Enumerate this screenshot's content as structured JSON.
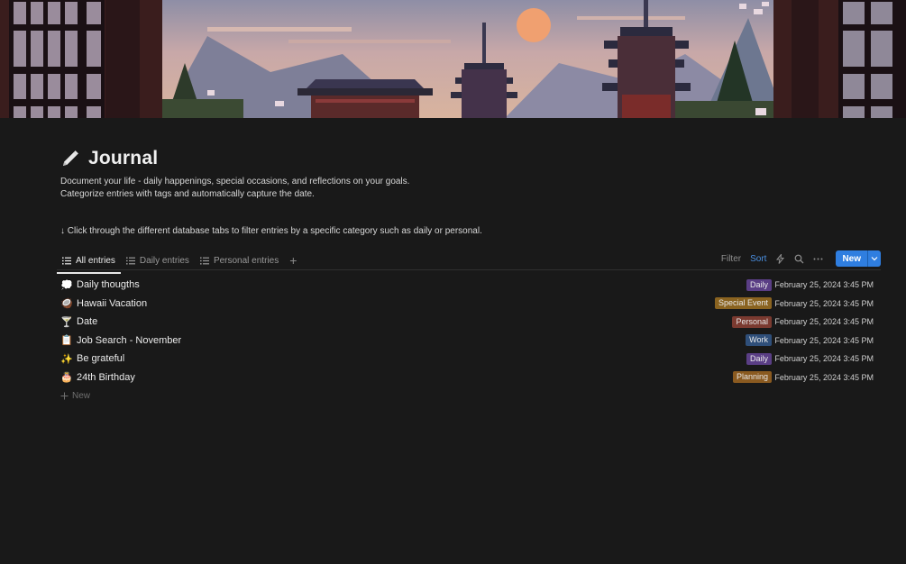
{
  "page": {
    "title": "Journal",
    "title_icon": "pencil-icon",
    "description_line1": "Document your life - daily happenings, special occasions, and reflections on your goals.",
    "description_line2": "Categorize entries with tags and automatically capture the date.",
    "hint": "↓ Click through the different database tabs to filter entries by a specific category such as daily or personal."
  },
  "tabs": [
    {
      "label": "All entries",
      "icon": "list-icon",
      "active": true
    },
    {
      "label": "Daily entries",
      "icon": "list-icon",
      "active": false
    },
    {
      "label": "Personal entries",
      "icon": "list-icon",
      "active": false
    }
  ],
  "add_tab": "+",
  "toolbar": {
    "filter_label": "Filter",
    "sort_label": "Sort",
    "automation_icon": "lightning-icon",
    "search_icon": "search-icon",
    "more_icon": "more-icon",
    "new_label": "New",
    "new_dropdown_icon": "chevron-down-icon"
  },
  "entries": [
    {
      "emoji": "💭",
      "title": "Daily thougths",
      "tag": "Daily",
      "tag_color": "#5a3e85",
      "date": "February 25, 2024 3:45 PM"
    },
    {
      "emoji": "🥥",
      "title": "Hawaii Vacation",
      "tag": "Special Event",
      "tag_color": "#8a6320",
      "date": "February 25, 2024 3:45 PM"
    },
    {
      "emoji": "🍸",
      "title": "Date",
      "tag": "Personal",
      "tag_color": "#7a3a30",
      "date": "February 25, 2024 3:45 PM"
    },
    {
      "emoji": "📋",
      "title": "Job Search - November",
      "tag": "Work",
      "tag_color": "#2f4f7a",
      "date": "February 25, 2024 3:45 PM"
    },
    {
      "emoji": "✨",
      "title": "Be grateful",
      "tag": "Daily",
      "tag_color": "#5a3e85",
      "date": "February 25, 2024 3:45 PM"
    },
    {
      "emoji": "🎂",
      "title": "24th Birthday",
      "tag": "Planning",
      "tag_color": "#8a5a20",
      "date": "February 25, 2024 3:45 PM"
    }
  ],
  "add_row_label": "New",
  "colors": {
    "background": "#191919",
    "accent": "#2f7ee0",
    "sort": "#4a8fe0"
  }
}
